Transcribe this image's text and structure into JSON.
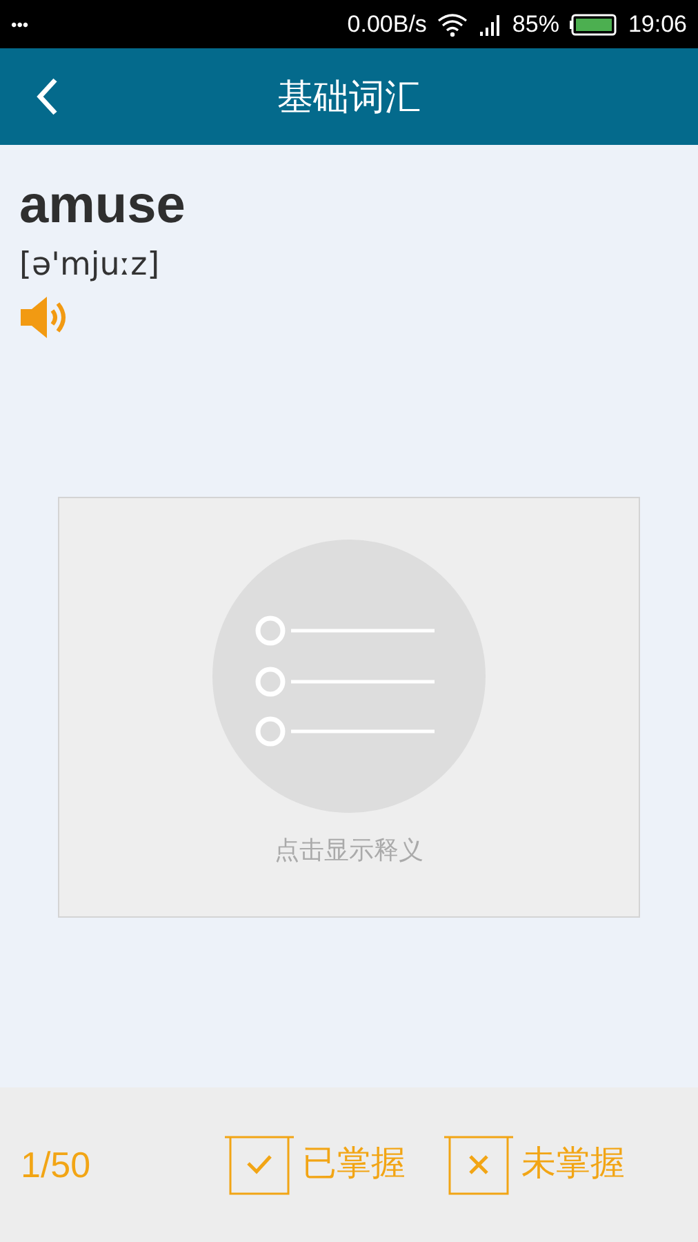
{
  "status_bar": {
    "menu": "•••",
    "speed": "0.00B/s",
    "battery": "85%",
    "time": "19:06"
  },
  "header": {
    "title": "基础词汇"
  },
  "word": {
    "text": "amuse",
    "phonetic": "[ə'mjuːz]"
  },
  "definition_card": {
    "hint": "点击显示释义"
  },
  "footer": {
    "progress": "1/50",
    "buttons": [
      {
        "kind": "known",
        "label": "已掌握"
      },
      {
        "kind": "unknown",
        "label": "未掌握"
      }
    ]
  }
}
